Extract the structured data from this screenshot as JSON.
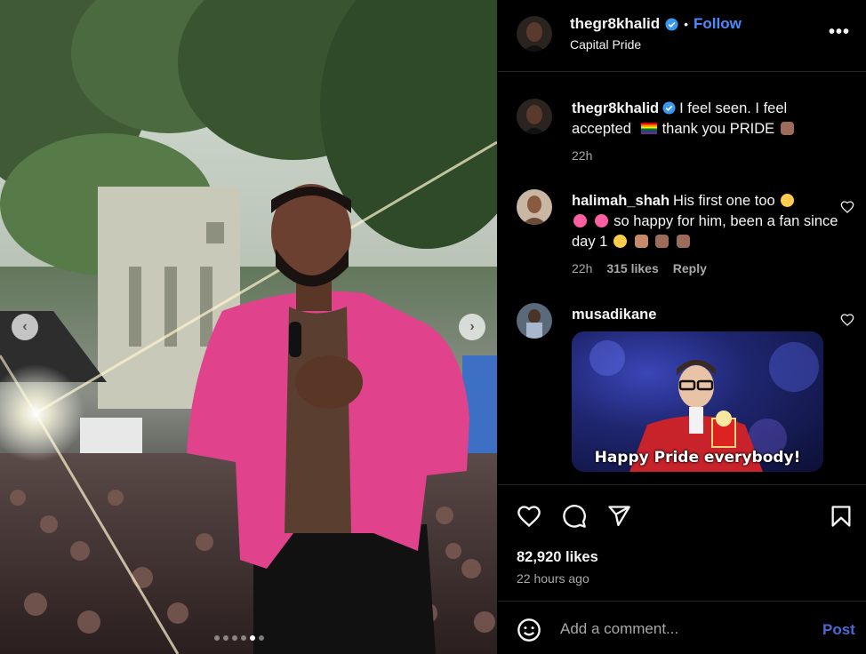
{
  "media": {
    "prev_icon": "chevron-left-icon",
    "next_icon": "chevron-right-icon",
    "carousel_count": 6,
    "carousel_active_index": 4
  },
  "header": {
    "username": "thegr8khalid",
    "separator": "•",
    "follow_label": "Follow",
    "location": "Capital Pride",
    "more_label": "•••"
  },
  "caption": {
    "username": "thegr8khalid",
    "text_part1": "I feel seen. I feel accepted",
    "text_part2": "thank you PRIDE",
    "time": "22h"
  },
  "comments": [
    {
      "username": "halimah_shah",
      "text_part1": "His first one too",
      "text_part2": "so happy for him, been a fan since day 1",
      "time": "22h",
      "likes": "315 likes",
      "reply_label": "Reply"
    },
    {
      "username": "musadikane",
      "gif_caption": "Happy Pride everybody!"
    }
  ],
  "actions": {
    "likes": "82,920 likes",
    "time_ago": "22 hours ago"
  },
  "add_comment": {
    "placeholder": "Add a comment...",
    "post_label": "Post"
  },
  "colors": {
    "accent": "#4a8cff",
    "post": "#4a6bd6",
    "muted": "#a8a8a8",
    "jacket": "#e0428c"
  }
}
